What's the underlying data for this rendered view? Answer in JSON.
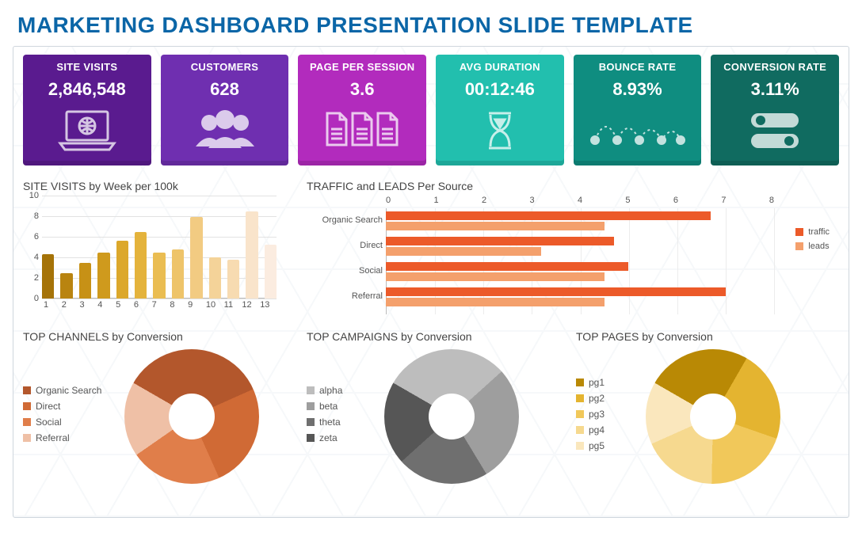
{
  "title": "MARKETING DASHBOARD PRESENTATION SLIDE TEMPLATE",
  "tiles": [
    {
      "label": "SITE VISITS",
      "value": "2,846,548",
      "color": "#5a1b8f"
    },
    {
      "label": "CUSTOMERS",
      "value": "628",
      "color": "#6f2fb0"
    },
    {
      "label": "PAGE PER SESSION",
      "value": "3.6",
      "color": "#b22bbd"
    },
    {
      "label": "AVG DURATION",
      "value": "00:12:46",
      "color": "#22bfae"
    },
    {
      "label": "BOUNCE RATE",
      "value": "8.93%",
      "color": "#0f8d80"
    },
    {
      "label": "CONVERSION RATE",
      "value": "3.11%",
      "color": "#106b60"
    }
  ],
  "sections": {
    "siteVisits": {
      "title": "SITE VISITS by Week per 100k"
    },
    "traffic": {
      "title": "TRAFFIC and LEADS Per Source"
    },
    "channels": {
      "title": "TOP CHANNELS by Conversion"
    },
    "campaigns": {
      "title": "TOP CAMPAIGNS by Conversion"
    },
    "pages": {
      "title": "TOP PAGES by Conversion"
    }
  },
  "chart_data": [
    {
      "id": "site_visits_week",
      "type": "bar",
      "title": "SITE VISITS by Week per 100k",
      "categories": [
        "1",
        "2",
        "3",
        "4",
        "5",
        "6",
        "7",
        "8",
        "9",
        "10",
        "11",
        "12",
        "13"
      ],
      "values": [
        4.3,
        2.5,
        3.5,
        4.5,
        5.6,
        6.5,
        4.5,
        4.8,
        7.9,
        4.0,
        3.8,
        8.5,
        5.2
      ],
      "ylim": [
        0,
        10
      ],
      "yticks": [
        0,
        2,
        4,
        6,
        8,
        10
      ],
      "colors": [
        "#a57308",
        "#b98410",
        "#c79116",
        "#cf9a1d",
        "#dca82b",
        "#e4b33c",
        "#eabd52",
        "#eec46a",
        "#f2cb82",
        "#f4d399",
        "#f7dbb1",
        "#f9e4cb",
        "#fbece0"
      ],
      "xlabel": "",
      "ylabel": ""
    },
    {
      "id": "traffic_leads",
      "type": "bar",
      "orientation": "horizontal",
      "title": "TRAFFIC and LEADS Per Source",
      "categories": [
        "Organic Search",
        "Direct",
        "Social",
        "Referral"
      ],
      "series": [
        {
          "name": "traffic",
          "color": "#ec5a29",
          "values": [
            6.7,
            4.7,
            5.0,
            7.0
          ]
        },
        {
          "name": "leads",
          "color": "#f4a06c",
          "values": [
            4.5,
            3.2,
            4.5,
            4.5
          ]
        }
      ],
      "xlim": [
        0,
        8
      ],
      "xticks": [
        0,
        1,
        2,
        3,
        4,
        5,
        6,
        7,
        8
      ],
      "legend": [
        "traffic",
        "leads"
      ]
    },
    {
      "id": "top_channels",
      "type": "pie",
      "title": "TOP CHANNELS by Conversion",
      "labels": [
        "Organic Search",
        "Direct",
        "Social",
        "Referral"
      ],
      "values": [
        35,
        25,
        22,
        18
      ],
      "colors": [
        "#b3572c",
        "#d06a35",
        "#e07e4a",
        "#efc0a6"
      ]
    },
    {
      "id": "top_campaigns",
      "type": "pie",
      "title": "TOP CAMPAIGNS by Conversion",
      "labels": [
        "alpha",
        "beta",
        "theta",
        "zeta"
      ],
      "values": [
        30,
        28,
        22,
        20
      ],
      "colors": [
        "#bdbdbd",
        "#9e9e9e",
        "#6f6f6f",
        "#565656"
      ]
    },
    {
      "id": "top_pages",
      "type": "pie",
      "title": "TOP PAGES by Conversion",
      "labels": [
        "pg1",
        "pg2",
        "pg3",
        "pg4",
        "pg5"
      ],
      "values": [
        25,
        22,
        20,
        18,
        15
      ],
      "colors": [
        "#b98905",
        "#e4b430",
        "#f1c85a",
        "#f6d98f",
        "#fae7bd"
      ]
    }
  ]
}
